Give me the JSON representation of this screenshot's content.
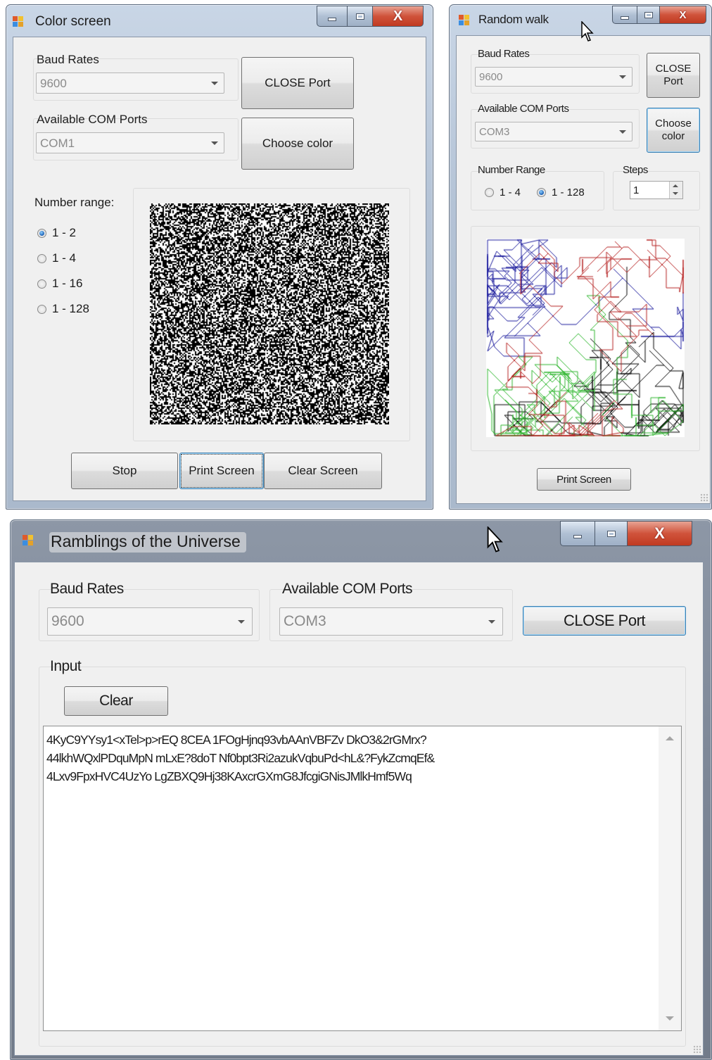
{
  "color_screen": {
    "title": "Color screen",
    "baud_rates_label": "Baud Rates",
    "baud_rate_value": "9600",
    "com_ports_label": "Available COM Ports",
    "com_port_value": "COM1",
    "close_port_label": "CLOSE Port",
    "choose_color_label": "Choose color",
    "number_range_label": "Number range:",
    "ranges": [
      {
        "label": "1 - 2",
        "selected": true
      },
      {
        "label": "1 - 4",
        "selected": false
      },
      {
        "label": "1 - 16",
        "selected": false
      },
      {
        "label": "1 - 128",
        "selected": false
      }
    ],
    "stop_label": "Stop",
    "print_screen_label": "Print Screen",
    "clear_screen_label": "Clear Screen"
  },
  "random_walk": {
    "title": "Random walk",
    "baud_rates_label": "Baud Rates",
    "baud_rate_value": "9600",
    "com_ports_label": "Available COM Ports",
    "com_port_value": "COM3",
    "close_port_label": "CLOSE Port",
    "choose_color_label": "Choose color",
    "number_range_label": "Number Range",
    "ranges": [
      {
        "label": "1 - 4",
        "selected": false
      },
      {
        "label": "1 - 128",
        "selected": true
      }
    ],
    "steps_label": "Steps",
    "steps_value": "1",
    "print_screen_label": "Print Screen",
    "walk_colors": [
      "#1a1a9c",
      "#000000",
      "#2db52d",
      "#b52020"
    ]
  },
  "ramblings": {
    "title": "Ramblings of the Universe",
    "baud_rates_label": "Baud Rates",
    "baud_rate_value": "9600",
    "com_ports_label": "Available COM Ports",
    "com_port_value": "COM3",
    "close_port_label": "CLOSE Port",
    "input_label": "Input",
    "clear_label": "Clear",
    "input_text": "4KyC9YYsy1<xTel>p>rEQ 8CEA 1FOgHjnq93vbAAnVBFZv DkO3&2rGMrx?\n44lkhWQxlPDquMpN mLxE?8doT Nf0bpt3Ri2azukVqbuPd<hL&?FykZcmqEf&\n4Lxv9FpxHVC4UzYo LgZBXQ9Hj38KAxcrGXmG8JfcgiGNisJMlkHmf5Wq"
  },
  "icons": [
    "app-icon",
    "minimize-icon",
    "maximize-icon",
    "close-icon",
    "mouse-cursor-icon",
    "dropdown-arrow-icon"
  ],
  "colors": {
    "accent": "#3c7fb1",
    "close_button": "#c8452b",
    "window_face": "#f0f0f0"
  }
}
